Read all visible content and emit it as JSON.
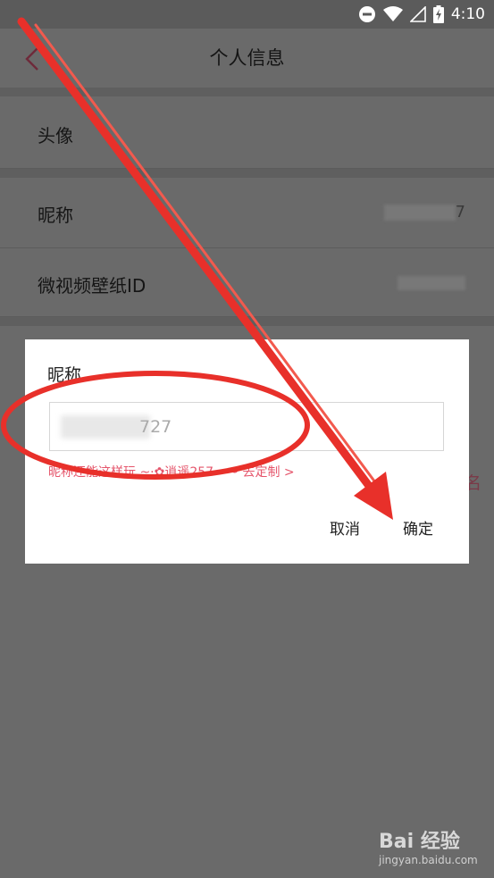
{
  "status_bar": {
    "time": "4:10",
    "icons": [
      "do-not-disturb-icon",
      "wifi-icon",
      "signal-icon",
      "battery-charging-icon"
    ]
  },
  "header": {
    "title": "个人信息",
    "back_icon": "chevron-left-icon"
  },
  "profile_rows": [
    {
      "label": "头像"
    },
    {
      "label": "昵称",
      "value": "7"
    },
    {
      "label": "微视频壁纸ID"
    }
  ],
  "background_fragment": "名",
  "dialog": {
    "title": "昵称",
    "input_value": "727",
    "hint": "昵称还能这样玩 ~·✿逍遥257~·~ 去定制 >",
    "cancel_label": "取消",
    "confirm_label": "确定"
  },
  "watermark": {
    "brand": "Bai 经验",
    "url": "jingyan.baidu.com"
  },
  "colors": {
    "dim_overlay": "#6a6a6a",
    "hint_pink": "#e5556b",
    "annotation_red": "#e8302a"
  }
}
